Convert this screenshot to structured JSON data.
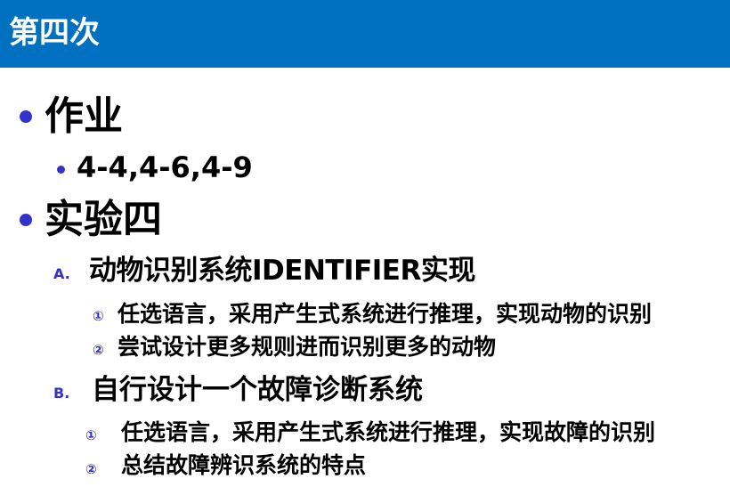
{
  "slide": {
    "title": "第四次",
    "colors": {
      "title_bar": "#0070c0",
      "title_text": "#ffffff",
      "bullet": "#3333cc",
      "body_text": "#000000"
    },
    "items": [
      {
        "text": "作业",
        "children": [
          {
            "text": "4-4,4-6,4-9"
          }
        ]
      },
      {
        "text": "实验四",
        "children": [
          {
            "marker": "A.",
            "text": "动物识别系统IDENTIFIER实现",
            "children": [
              {
                "marker": "①",
                "text": "任选语言，采用产生式系统进行推理，实现动物的识别"
              },
              {
                "marker": "②",
                "text": "尝试设计更多规则进而识别更多的动物"
              }
            ]
          },
          {
            "marker": "B.",
            "text": "自行设计一个故障诊断系统",
            "children": [
              {
                "marker": "①",
                "text": "任选语言，采用产生式系统进行推理，实现故障的识别"
              },
              {
                "marker": "②",
                "text": "总结故障辨识系统的特点"
              }
            ]
          }
        ]
      }
    ]
  }
}
